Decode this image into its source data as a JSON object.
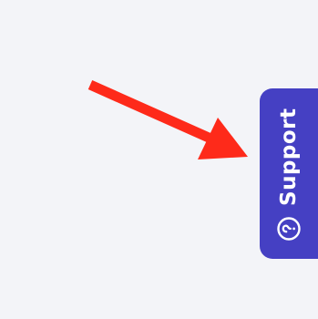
{
  "support_tab": {
    "label": "Support",
    "icon": "help-circle-icon",
    "background_color": "#4540c3",
    "text_color": "#ffffff"
  },
  "annotation": {
    "icon": "arrow-icon",
    "color": "#fe2a1a"
  },
  "page": {
    "background_color": "#f3f4f8"
  }
}
